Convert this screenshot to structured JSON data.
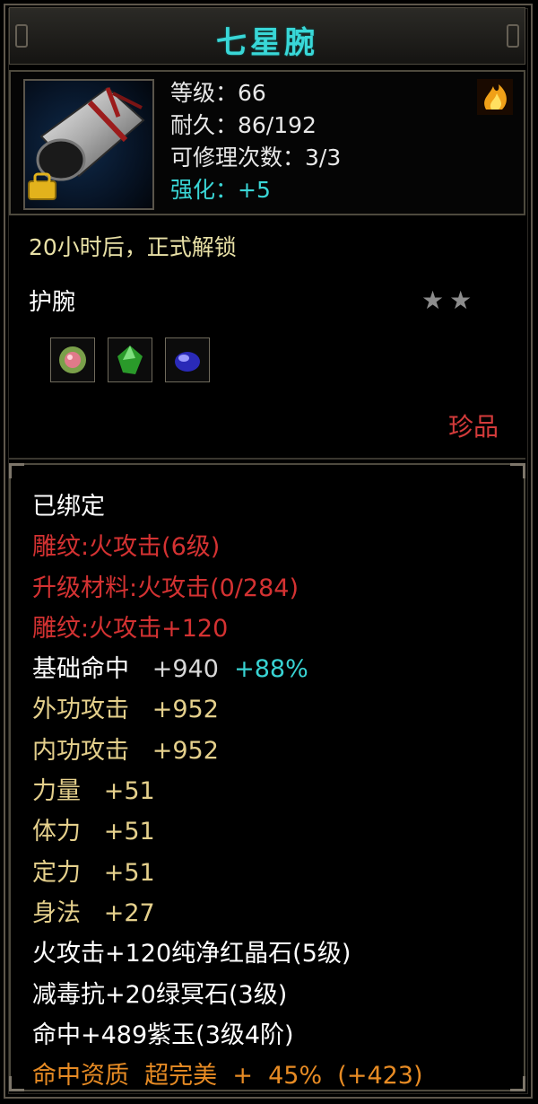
{
  "item": {
    "name": "七星腕",
    "stats": {
      "level": "等级：66",
      "durability": "耐久：86/192",
      "repairs": "可修理次数：3/3",
      "enhance": "强化：+5"
    },
    "unlock_text": "20小时后，正式解锁",
    "slot_type": "护腕",
    "stars": "★★",
    "quality": "珍品",
    "gems": [
      "pink-gem-icon",
      "green-gem-icon",
      "blue-gem-icon"
    ]
  },
  "details": {
    "bound": "已绑定",
    "engrave": "雕纹:火攻击(6级)",
    "upgrade_material": "升级材料:火攻击(0/284)",
    "engrave_bonus": "雕纹:火攻击+120",
    "base_hit_label": "基础命中",
    "base_hit_value": "+940",
    "base_hit_pct": "+88%",
    "outer_atk_label": "外功攻击",
    "outer_atk_value": "+952",
    "inner_atk_label": "内功攻击",
    "inner_atk_value": "+952",
    "strength_label": "力量",
    "strength_value": "+51",
    "stamina_label": "体力",
    "stamina_value": "+51",
    "focus_label": "定力",
    "focus_value": "+51",
    "agility_label": "身法",
    "agility_value": "+27",
    "gem1": "火攻击+120纯净红晶石(5级)",
    "gem2": "减毒抗+20绿冥石(3级)",
    "gem3": "命中+489紫玉(3级4阶)",
    "aptitude": "命中资质  超完美  +  45%  (+423)"
  },
  "colors": {
    "title": "#39d7d7",
    "engrave": "#d43232",
    "attribute": "#e5d08c",
    "bonus_pct": "#38d3d3",
    "aptitude": "#e78b24",
    "quality": "#d43b3b"
  }
}
